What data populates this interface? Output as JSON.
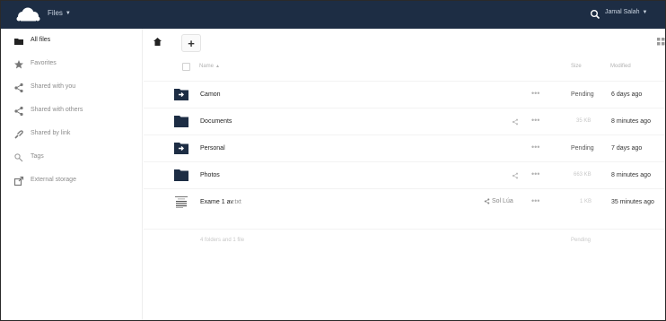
{
  "header": {
    "app_name": "Files",
    "user_name": "Jamal Salah"
  },
  "sidebar": {
    "items": [
      {
        "label": "All files",
        "icon": "folder-icon"
      },
      {
        "label": "Favorites",
        "icon": "star-icon"
      },
      {
        "label": "Shared with you",
        "icon": "share-icon"
      },
      {
        "label": "Shared with others",
        "icon": "share-icon"
      },
      {
        "label": "Shared by link",
        "icon": "link-icon"
      },
      {
        "label": "Tags",
        "icon": "tag-icon"
      },
      {
        "label": "External storage",
        "icon": "external-storage-icon"
      }
    ]
  },
  "table": {
    "columns": {
      "name": "Name",
      "size": "Size",
      "modified": "Modified"
    },
    "rows": [
      {
        "name": "Camon",
        "ext": "",
        "type": "shared-folder",
        "share_label": "",
        "size": "Pending",
        "modified": "6 days ago"
      },
      {
        "name": "Documents",
        "ext": "",
        "type": "folder",
        "share_label": "",
        "size": "35 KB",
        "modified": "8 minutes ago"
      },
      {
        "name": "Personal",
        "ext": "",
        "type": "shared-folder",
        "share_label": "",
        "size": "Pending",
        "modified": "7 days ago"
      },
      {
        "name": "Photos",
        "ext": "",
        "type": "folder",
        "share_label": "",
        "size": "663 KB",
        "modified": "8 minutes ago"
      },
      {
        "name": "Exame 1 av",
        "ext": ".txt",
        "type": "document",
        "share_label": "Sol Lúa",
        "size": "1 KB",
        "modified": "35 minutes ago"
      }
    ],
    "summary": {
      "text": "4 folders and 1 file",
      "size": "Pending"
    }
  },
  "colors": {
    "header_bg": "#1d2d44",
    "folder": "#1d2d44",
    "accent": "#1d2d44"
  }
}
